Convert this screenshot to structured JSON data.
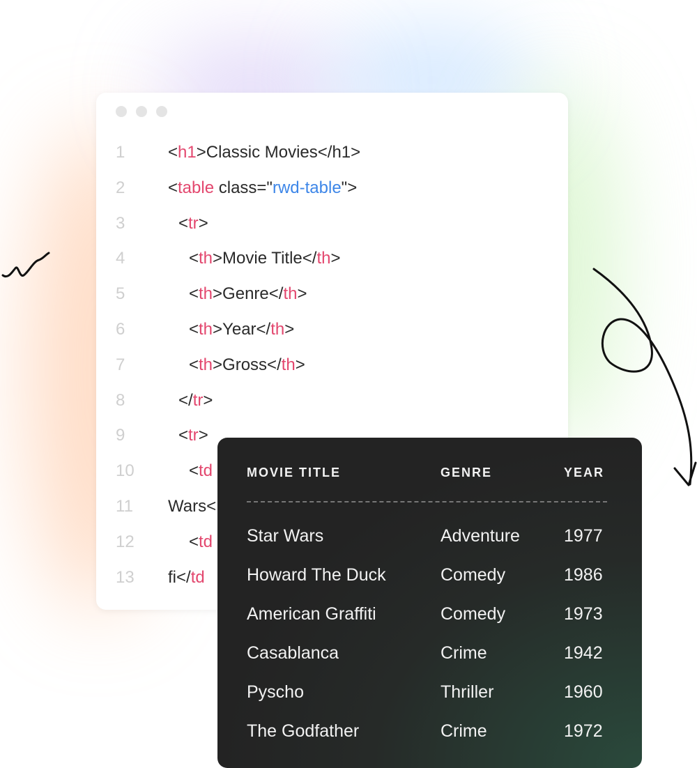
{
  "code_lines": [
    {
      "n": "1",
      "parts": [
        [
          "",
          "<"
        ],
        [
          "tag",
          "h1"
        ],
        [
          "",
          ">Classic Movies</h1>"
        ]
      ],
      "indent": 0
    },
    {
      "n": "2",
      "parts": [
        [
          "",
          "<"
        ],
        [
          "tag",
          "table"
        ],
        [
          "",
          " class=\""
        ],
        [
          "str",
          "rwd-table"
        ],
        [
          "",
          "\">"
        ]
      ],
      "indent": 0
    },
    {
      "n": "3",
      "parts": [
        [
          "",
          "<"
        ],
        [
          "tag",
          "tr"
        ],
        [
          "",
          ">"
        ]
      ],
      "indent": 1
    },
    {
      "n": "4",
      "parts": [
        [
          "",
          "<"
        ],
        [
          "tag",
          "th"
        ],
        [
          "",
          ">Movie Title</"
        ],
        [
          "tag",
          "th"
        ],
        [
          "",
          ">"
        ]
      ],
      "indent": 2
    },
    {
      "n": "5",
      "parts": [
        [
          "",
          "<"
        ],
        [
          "tag",
          "th"
        ],
        [
          "",
          ">Genre</"
        ],
        [
          "tag",
          "th"
        ],
        [
          "",
          ">"
        ]
      ],
      "indent": 2
    },
    {
      "n": "6",
      "parts": [
        [
          "",
          "<"
        ],
        [
          "tag",
          "th"
        ],
        [
          "",
          ">Year</"
        ],
        [
          "tag",
          "th"
        ],
        [
          "",
          ">"
        ]
      ],
      "indent": 2
    },
    {
      "n": "7",
      "parts": [
        [
          "",
          "<"
        ],
        [
          "tag",
          "th"
        ],
        [
          "",
          ">Gross</"
        ],
        [
          "tag",
          "th"
        ],
        [
          "",
          ">"
        ]
      ],
      "indent": 2
    },
    {
      "n": "8",
      "parts": [
        [
          "",
          "</"
        ],
        [
          "tag",
          "tr"
        ],
        [
          "",
          ">"
        ]
      ],
      "indent": 1
    },
    {
      "n": "9",
      "parts": [
        [
          "",
          "<"
        ],
        [
          "tag",
          "tr"
        ],
        [
          "",
          ">"
        ]
      ],
      "indent": 1
    },
    {
      "n": "10",
      "parts": [
        [
          "",
          "<"
        ],
        [
          "tag",
          "td"
        ]
      ],
      "indent": 2
    },
    {
      "n": "11",
      "parts": [
        [
          "",
          "Wars<"
        ]
      ],
      "indent": 0
    },
    {
      "n": "12",
      "parts": [
        [
          "",
          "<"
        ],
        [
          "tag",
          "td"
        ]
      ],
      "indent": 2
    },
    {
      "n": "13",
      "parts": [
        [
          "",
          "fi</"
        ],
        [
          "tag",
          "td"
        ]
      ],
      "indent": 0
    }
  ],
  "table": {
    "headers": [
      "MOVIE TITLE",
      "GENRE",
      "YEAR"
    ],
    "rows": [
      [
        "Star Wars",
        "Adventure",
        "1977"
      ],
      [
        "Howard The Duck",
        "Comedy",
        "1986"
      ],
      [
        "American Graffiti",
        "Comedy",
        "1973"
      ],
      [
        "Casablanca",
        "Crime",
        "1942"
      ],
      [
        "Pyscho",
        "Thriller",
        "1960"
      ],
      [
        "The Godfather",
        "Crime",
        "1972"
      ]
    ]
  },
  "colors": {
    "tag": "#e3476e",
    "string": "#3d86e8",
    "card": "#232323"
  }
}
